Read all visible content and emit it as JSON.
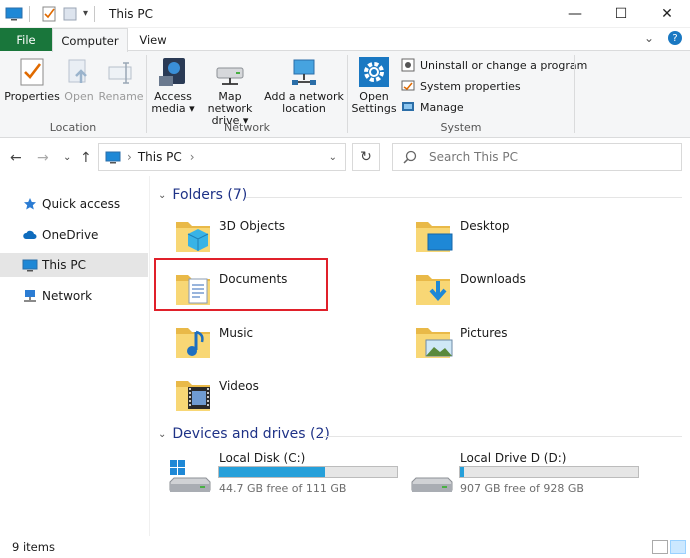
{
  "window": {
    "title": "This PC",
    "minimize_glyph": "—",
    "maximize_glyph": "☐",
    "close_glyph": "✕"
  },
  "ribbon_tabs": {
    "file": "File",
    "computer": "Computer",
    "view": "View",
    "collapse_glyph": "⌄",
    "help_glyph": "?"
  },
  "ribbon": {
    "location": {
      "label": "Location",
      "properties": "Properties",
      "open": "Open",
      "rename": "Rename"
    },
    "network": {
      "label": "Network",
      "access_media_line1": "Access",
      "access_media_line2": "media ▾",
      "map_drive_line1": "Map network",
      "map_drive_line2": "drive ▾",
      "add_location_line1": "Add a network",
      "add_location_line2": "location"
    },
    "system": {
      "label": "System",
      "open_settings_line1": "Open",
      "open_settings_line2": "Settings",
      "uninstall": "Uninstall or change a program",
      "system_properties": "System properties",
      "manage": "Manage"
    }
  },
  "navigation": {
    "back": "←",
    "forward": "→",
    "recent": "⌄",
    "up": "↑",
    "breadcrumb": "This PC",
    "breadcrumb_chevron": "›",
    "dropdown": "⌄",
    "refresh": "↻",
    "search_placeholder": "Search This PC"
  },
  "nav_pane": {
    "items": [
      {
        "label": "Quick access"
      },
      {
        "label": "OneDrive"
      },
      {
        "label": "This PC"
      },
      {
        "label": "Network"
      }
    ]
  },
  "content": {
    "folders_header": "Folders (7)",
    "folders": [
      {
        "label": "3D Objects"
      },
      {
        "label": "Desktop"
      },
      {
        "label": "Documents"
      },
      {
        "label": "Downloads"
      },
      {
        "label": "Music"
      },
      {
        "label": "Pictures"
      },
      {
        "label": "Videos"
      }
    ],
    "drives_header": "Devices and drives (2)",
    "drives": [
      {
        "label": "Local Disk (C:)",
        "free_text": "44.7 GB free of 111 GB",
        "used_fraction": 0.597
      },
      {
        "label": "Local Drive D (D:)",
        "free_text": "907 GB free of 928 GB",
        "used_fraction": 0.023
      }
    ]
  },
  "status": {
    "item_count": "9 items"
  },
  "colors": {
    "file_tab": "#19763b",
    "drive_fill": "#26a0da",
    "highlight_box": "#e0202a",
    "section_header": "#1e3287"
  }
}
